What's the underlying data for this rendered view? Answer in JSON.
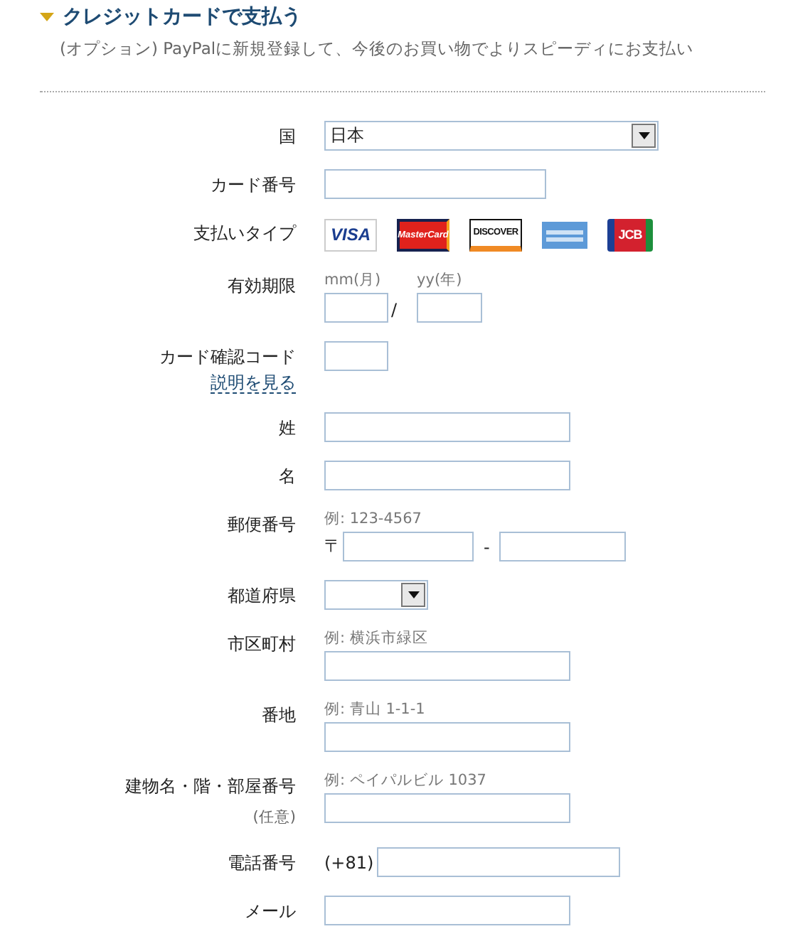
{
  "section": {
    "title": "クレジットカードで支払う",
    "expanded": true,
    "subtitle": "(オプション) PayPalに新規登録して、今後のお買い物でよりスピーディにお支払い"
  },
  "rows": [
    {
      "kind": "select",
      "label": "国",
      "value": "日本"
    },
    {
      "kind": "mediumtext",
      "label": "カード番号"
    },
    {
      "kind": "cards",
      "label": "支払いタイプ",
      "cards": [
        {
          "kind": "visa",
          "text": "VISA"
        },
        {
          "kind": "mastercard",
          "text": "MasterCard"
        },
        {
          "kind": "discover",
          "text": "DISCOVER"
        },
        {
          "kind": "amex"
        },
        {
          "kind": "jcb",
          "text": "JCB"
        }
      ]
    },
    {
      "kind": "expiry",
      "label": "有効期限",
      "month_hint": "mm(月)",
      "year_hint": "yy(年)",
      "separator": "/"
    },
    {
      "kind": "shorttext",
      "label": "カード確認コード",
      "link": "説明を見る"
    },
    {
      "kind": "text",
      "label": "姓"
    },
    {
      "kind": "text",
      "label": "名"
    },
    {
      "kind": "postal",
      "label": "郵便番号",
      "hint": "例: 123-4567",
      "prefix": "〒",
      "separator": "-"
    },
    {
      "kind": "smallselect",
      "label": "都道府県"
    },
    {
      "kind": "text",
      "label": "市区町村",
      "hint": "例: 横浜市緑区"
    },
    {
      "kind": "text",
      "label": "番地",
      "hint": "例: 青山 1-1-1"
    },
    {
      "kind": "text",
      "label": "建物名・階・部屋番号",
      "note": "(任意)",
      "hint": "例: ペイパルビル 1037"
    },
    {
      "kind": "phone",
      "label": "電話番号",
      "prefix": "(+81)"
    },
    {
      "kind": "text",
      "label": "メール"
    }
  ]
}
